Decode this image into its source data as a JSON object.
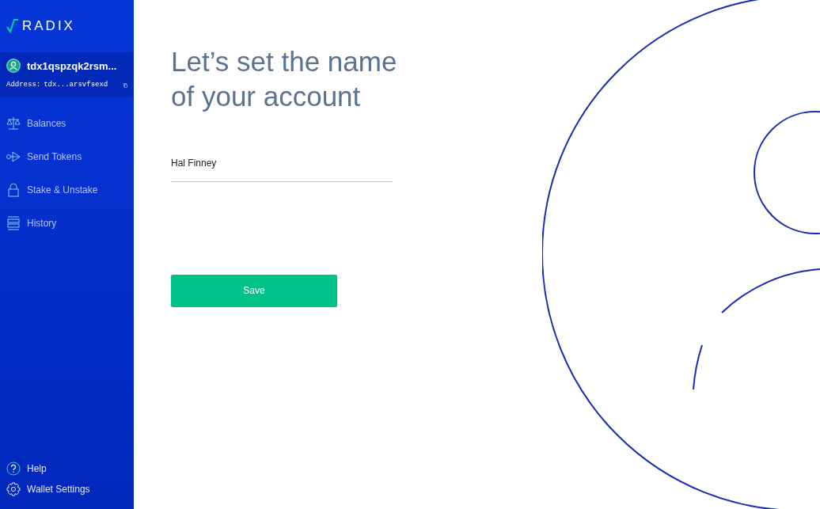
{
  "logo": {
    "text": "RADIX"
  },
  "account": {
    "name": "tdx1qspzqk2rsm...",
    "address_label": "Address:",
    "address": "tdx...arsvfsexd"
  },
  "nav": [
    {
      "label": "Balances",
      "kind": "scale"
    },
    {
      "label": "Send Tokens",
      "kind": "send"
    },
    {
      "label": "Stake & Unstake",
      "kind": "lock"
    },
    {
      "label": "History",
      "kind": "history"
    }
  ],
  "footer_nav": [
    {
      "label": "Help",
      "kind": "help"
    },
    {
      "label": "Wallet Settings",
      "kind": "gear"
    }
  ],
  "form": {
    "title": "Let’s set the name of your account",
    "name_value": "Hal Finney",
    "save_button": "Save"
  }
}
